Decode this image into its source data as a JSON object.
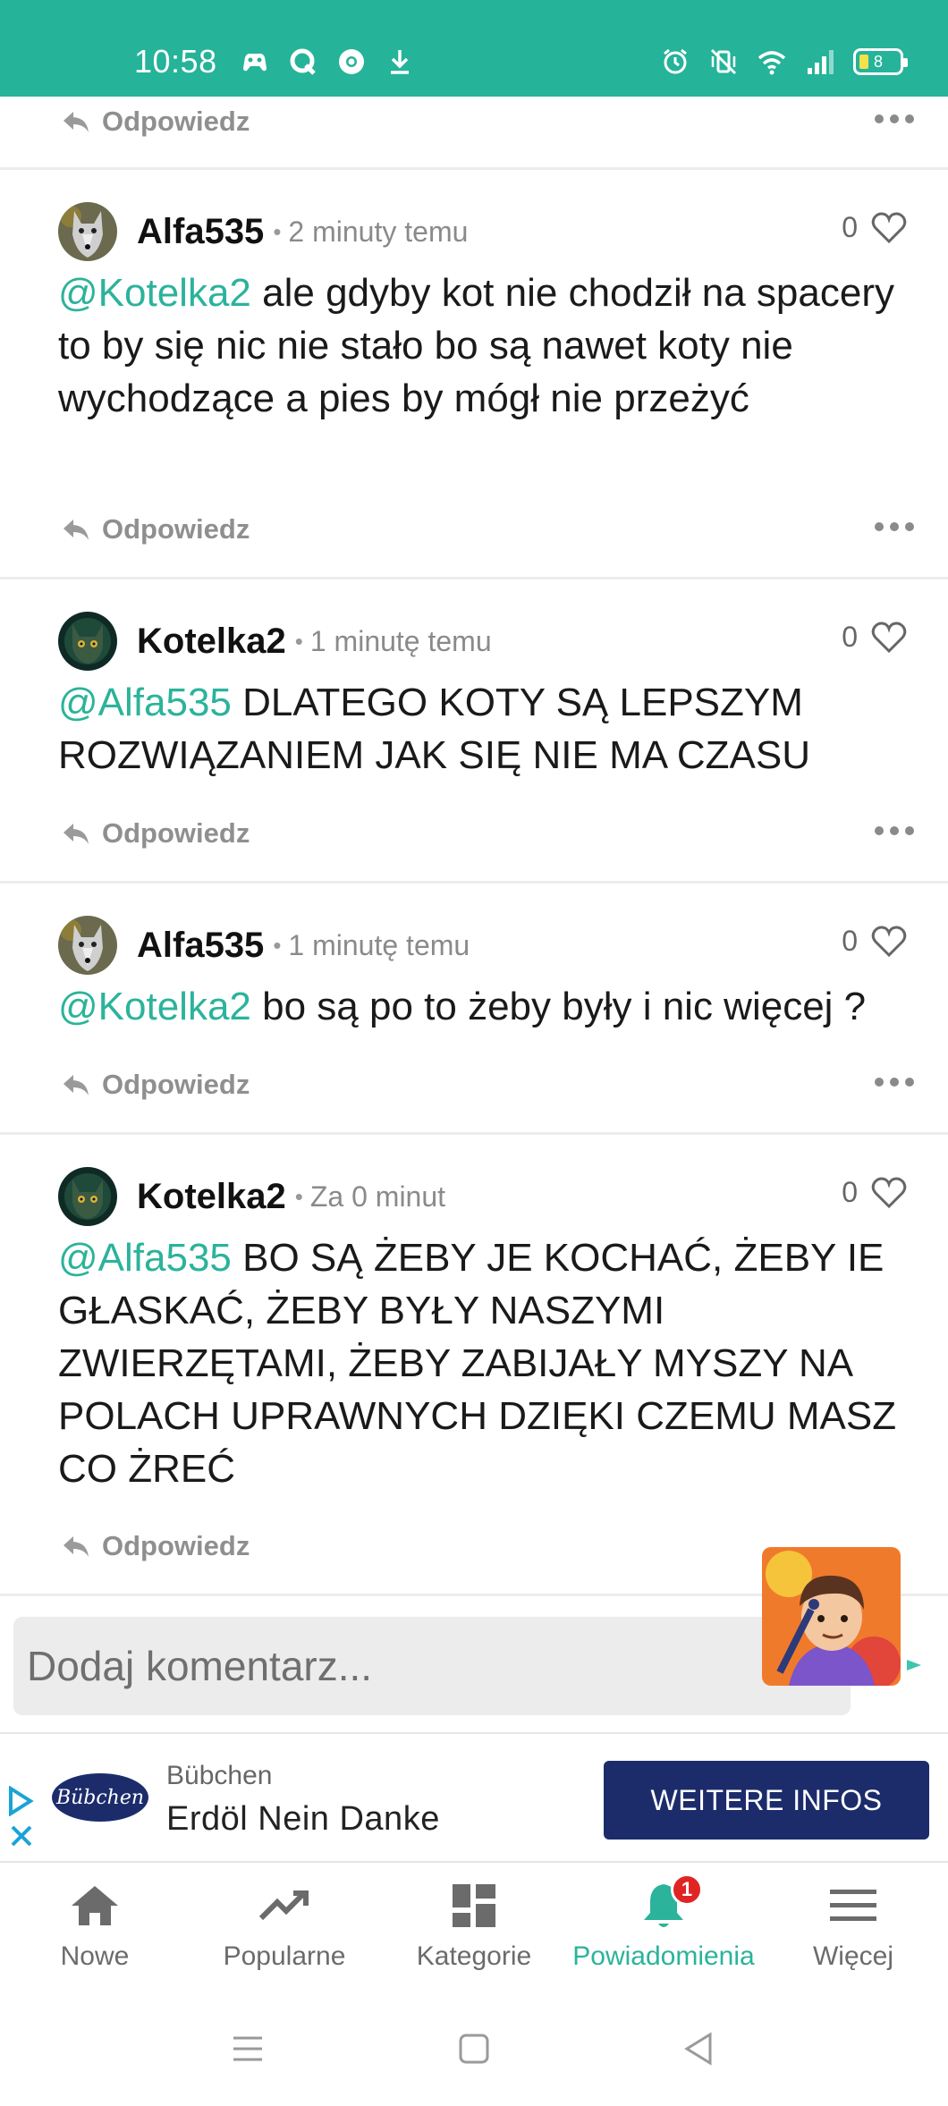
{
  "status_bar": {
    "time": "10:58",
    "battery": "8",
    "background": "#25b39a"
  },
  "top_row": {
    "reply_label": "Odpowiedz"
  },
  "comments": [
    {
      "user": "Alfa535",
      "time": "2 minuty temu",
      "likes": "0",
      "mention": "@Kotelka2",
      "text": " ale gdyby kot nie chodził na spacery to by się nic nie stało bo są nawet koty nie wychodzące a pies by mógł nie przeżyć",
      "reply_label": "Odpowiedz",
      "avatar": "wolf-avatar"
    },
    {
      "user": "Kotelka2",
      "time": "1 minutę temu",
      "likes": "0",
      "mention": "@Alfa535",
      "text": " DLATEGO KOTY SĄ LEPSZYM ROZWIĄZANIEM JAK SIĘ NIE MA CZASU",
      "reply_label": "Odpowiedz",
      "avatar": "cat-avatar"
    },
    {
      "user": "Alfa535",
      "time": "1 minutę temu",
      "likes": "0",
      "mention": "@Kotelka2",
      "text": " bo są po to żeby były i nic więcej ?",
      "reply_label": "Odpowiedz",
      "avatar": "wolf-avatar"
    },
    {
      "user": "Kotelka2",
      "time": "Za 0 minut",
      "likes": "0",
      "mention": "@Alfa535",
      "text": " BO SĄ ŻEBY JE KOCHAĆ, ŻEBY IE GŁASKAĆ, ŻEBY BYŁY NASZYMI ZWIERZĘTAMI, ŻEBY ZABIJAŁY MYSZY NA POLACH UPRAWNYCH DZIĘKI CZEMU MASZ CO ŻREĆ",
      "reply_label": "Odpowiedz",
      "avatar": "cat-avatar"
    }
  ],
  "comment_input": {
    "placeholder": "Dodaj komentarz..."
  },
  "ad": {
    "logo_text": "Bübchen",
    "brand": "Bübchen",
    "headline": "Erdöl Nein Danke",
    "cta": "WEITERE INFOS",
    "color": "#1c2c6b"
  },
  "bottom_nav": {
    "items": [
      {
        "label": "Nowe",
        "icon": "home-icon"
      },
      {
        "label": "Popularne",
        "icon": "trending-icon"
      },
      {
        "label": "Kategorie",
        "icon": "grid-icon"
      },
      {
        "label": "Powiadomienia",
        "icon": "bell-icon",
        "badge": "1"
      },
      {
        "label": "Więcej",
        "icon": "menu-icon"
      }
    ],
    "active_color": "#2bb39b"
  }
}
